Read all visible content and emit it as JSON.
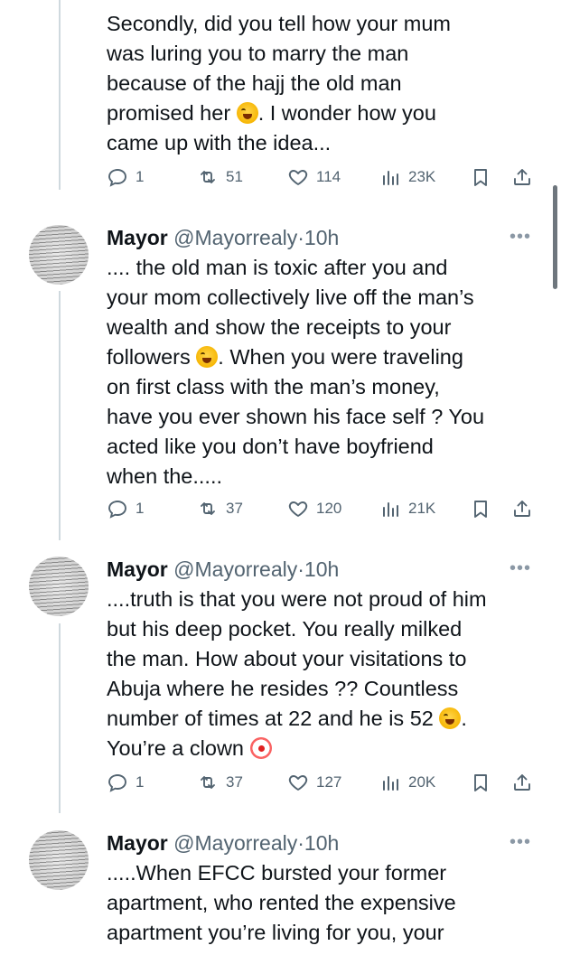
{
  "first_tweet": {
    "lines": [
      "Secondly, did you tell how your mum",
      "was luring you to marry the man",
      "because of the hajj the old man",
      "promised her",
      ".  I wonder how you",
      "came up with the idea..."
    ],
    "emoji": "laughing-tears-emoji",
    "stats": {
      "replies": "1",
      "reposts": "51",
      "likes": "114",
      "views": "23K"
    }
  },
  "tweets": [
    {
      "name": "Mayor",
      "handle": "@Mayorrealy",
      "dot": "·",
      "time": "10h",
      "lines": [
        ".... the old man is toxic after you and",
        "your mom collectively live off the man’s",
        "wealth and show the receipts to your",
        "followers",
        ". When you were traveling",
        "on first class with the man’s money,",
        "have you ever shown his face self ? You",
        "acted like you don’t have boyfriend",
        "when the....."
      ],
      "stats": {
        "replies": "1",
        "reposts": "37",
        "likes": "120",
        "views": "21K"
      }
    },
    {
      "name": "Mayor",
      "handle": "@Mayorrealy",
      "dot": "·",
      "time": "10h",
      "lines": [
        "....truth is that you were not proud of him",
        "but his deep pocket. You really milked",
        "the man. How about your visitations to",
        "Abuja where he resides ?? Countless",
        "number of times at 22 and he is 52",
        ".",
        "You’re a clown"
      ],
      "stats": {
        "replies": "1",
        "reposts": "37",
        "likes": "127",
        "views": "20K"
      }
    },
    {
      "name": "Mayor",
      "handle": "@Mayorrealy",
      "dot": "·",
      "time": "10h",
      "lines": [
        ".....When EFCC bursted your former",
        "apartment, who rented the expensive",
        "apartment you’re living for you, your"
      ]
    }
  ],
  "more_label": "•••"
}
